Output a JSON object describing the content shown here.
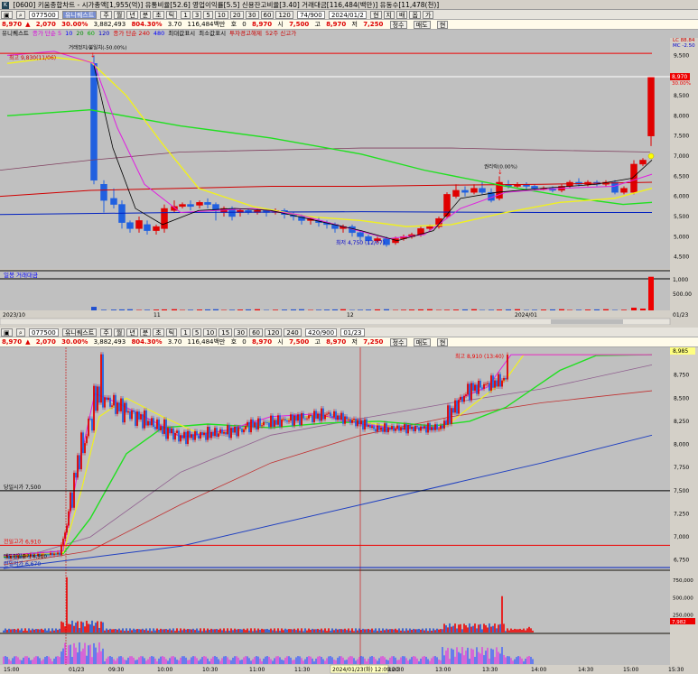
{
  "title_bar": {
    "text": "[0600] 키움종합차트 - 시가총액[1,955(억)] 유통비율[52.6] 영업이익률[5.5] 신용잔고비율[3.40] 거래대금[116,484(백만)] 유동수[11,478(천)]"
  },
  "top_toolbar": {
    "code": "077500",
    "name": "유니퀘스트",
    "periods": [
      "주",
      "월",
      "년",
      "분",
      "초",
      "틱"
    ],
    "intervals": [
      "1",
      "3",
      "5",
      "10",
      "20",
      "30",
      "60",
      "120"
    ],
    "count": "74/900",
    "date": "2024/01/2",
    "buttons": [
      "현",
      "지",
      "배",
      "옵",
      "가"
    ]
  },
  "top_info": {
    "price": "8,970",
    "change": "2,070",
    "pct": "30.00%",
    "volume": "3,882,493",
    "vol_ratio": "804.30%",
    "amount": "3.70",
    "amount_m": "116,484백만",
    "ho": "호",
    "ho_val": "0",
    "open_label": "시",
    "open": "7,500",
    "high_label": "고",
    "high": "8,970",
    "low_label": "저",
    "low": "7,250",
    "label_jeong": "정수",
    "label_wat": "매도",
    "label_buy": "현"
  },
  "top_legend": {
    "items": [
      "유니퀘스트",
      "종가 단순 5",
      "10",
      "20",
      "60",
      "120",
      "종가 단순 240",
      "480",
      "최대값표시",
      "최소값표시",
      "투자경고해제",
      "52주 신고가"
    ],
    "right_top": "LC 88.84",
    "right_bot": "MC -2.50"
  },
  "top_chart": {
    "price_labels": [
      "9,500",
      "9,000",
      "8,500",
      "8,000",
      "7,500",
      "7,000",
      "6,500",
      "6,000",
      "5,500",
      "5,000",
      "4,500"
    ],
    "current_label": "8,970",
    "current_pct": "30.00%",
    "annot_high": "최고 9,830(11/06)",
    "annot_limit": "거래정지/불일치(-50.00%)",
    "annot_low": "최저 4,750 (12/07)",
    "annot_ex": "권리락(0.00%)",
    "x_labels": [
      "2023/10",
      "11",
      "12",
      "2024/01"
    ],
    "x_right": "01/23"
  },
  "top_volume": {
    "label": "일봉 거래대금",
    "y_labels": [
      "1,000",
      "500.00"
    ]
  },
  "bot_toolbar": {
    "code": "077500",
    "name": "유니퀘스트",
    "periods": [
      "주",
      "월",
      "년",
      "분",
      "초",
      "틱"
    ],
    "intervals": [
      "1",
      "5",
      "10",
      "15",
      "30",
      "60",
      "120",
      "240"
    ],
    "count": "420/900",
    "date": "01/23"
  },
  "bot_info": {
    "price": "8,970",
    "change": "2,070",
    "pct": "30.00%",
    "volume": "3,882,493",
    "vol_ratio": "804.30%",
    "amount": "3.70",
    "amount_m": "116,484백만",
    "ho": "호",
    "ho_val": "0",
    "open_label": "시",
    "open": "7,500",
    "high_label": "고",
    "high": "8,970",
    "low_label": "저",
    "low": "7,250",
    "label_jeong": "정수",
    "label_wat": "매도",
    "label_buy": "현"
  },
  "bot_chart": {
    "price_labels": [
      "8,750",
      "8,500",
      "8,250",
      "8,000",
      "7,750",
      "7,500",
      "7,250",
      "7,000",
      "6,750"
    ],
    "current_label": "8,985",
    "annot_high": "최고 8,910 (13:40)",
    "annot_open": "당일시가 7,500",
    "annot_prevhigh": "전일고가 6,910",
    "annot_prevclose": "매도전일종가 6,910",
    "annot_prevlow": "전일저가 6,670",
    "vol_labels": [
      "750,000",
      "500,000",
      "250,000"
    ],
    "vol_current": "7,982",
    "x_labels": [
      "15:00",
      "01/23",
      "09:30",
      "10:00",
      "10:30",
      "11:00",
      "11:30",
      "12:00",
      "12:30",
      "13:00",
      "13:30",
      "14:00",
      "14:30",
      "15:00",
      "15:30"
    ],
    "x_cursor": "2024/01/23(화) 12:09:00"
  }
}
